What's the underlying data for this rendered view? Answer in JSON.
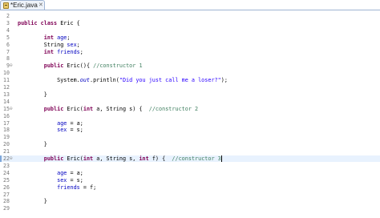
{
  "tab": {
    "label": "*Eric.java",
    "icon": "java-file-icon",
    "close_icon": "close-icon",
    "close_glyph": "✕"
  },
  "fold_glyph": "⊖",
  "colors": {
    "keyword": "#7f0055",
    "comment": "#3f7f5f",
    "string": "#2a00ff",
    "field": "#0000c0",
    "current_line": "#e8f2fe"
  },
  "current_line": 22,
  "lines": [
    {
      "num": "2",
      "fold": false,
      "tokens": []
    },
    {
      "num": "3",
      "fold": false,
      "tokens": [
        {
          "t": "kw",
          "v": "public"
        },
        {
          "t": "tx",
          "v": " "
        },
        {
          "t": "kw",
          "v": "class"
        },
        {
          "t": "tx",
          "v": " Eric {"
        }
      ]
    },
    {
      "num": "4",
      "fold": false,
      "tokens": []
    },
    {
      "num": "5",
      "fold": false,
      "tokens": [
        {
          "t": "tx",
          "v": "        "
        },
        {
          "t": "kw",
          "v": "int"
        },
        {
          "t": "tx",
          "v": " "
        },
        {
          "t": "fd",
          "v": "age"
        },
        {
          "t": "tx",
          "v": ";"
        }
      ]
    },
    {
      "num": "6",
      "fold": false,
      "tokens": [
        {
          "t": "tx",
          "v": "        String "
        },
        {
          "t": "fd",
          "v": "sex"
        },
        {
          "t": "tx",
          "v": ";"
        }
      ]
    },
    {
      "num": "7",
      "fold": false,
      "tokens": [
        {
          "t": "tx",
          "v": "        "
        },
        {
          "t": "kw",
          "v": "int"
        },
        {
          "t": "tx",
          "v": " "
        },
        {
          "t": "fd",
          "v": "friends"
        },
        {
          "t": "tx",
          "v": ";"
        }
      ]
    },
    {
      "num": "8",
      "fold": false,
      "tokens": []
    },
    {
      "num": "9",
      "fold": true,
      "tokens": [
        {
          "t": "tx",
          "v": "        "
        },
        {
          "t": "kw",
          "v": "public"
        },
        {
          "t": "tx",
          "v": " Eric(){ "
        },
        {
          "t": "cm",
          "v": "//constructor 1"
        }
      ]
    },
    {
      "num": "10",
      "fold": false,
      "tokens": []
    },
    {
      "num": "11",
      "fold": false,
      "tokens": [
        {
          "t": "tx",
          "v": "            System."
        },
        {
          "t": "fs",
          "v": "out"
        },
        {
          "t": "tx",
          "v": ".println("
        },
        {
          "t": "st",
          "v": "\"Did you just call me a loser?\""
        },
        {
          "t": "tx",
          "v": ");"
        }
      ]
    },
    {
      "num": "12",
      "fold": false,
      "tokens": []
    },
    {
      "num": "13",
      "fold": false,
      "tokens": [
        {
          "t": "tx",
          "v": "        }"
        }
      ]
    },
    {
      "num": "14",
      "fold": false,
      "tokens": []
    },
    {
      "num": "15",
      "fold": true,
      "tokens": [
        {
          "t": "tx",
          "v": "        "
        },
        {
          "t": "kw",
          "v": "public"
        },
        {
          "t": "tx",
          "v": " Eric("
        },
        {
          "t": "kw",
          "v": "int"
        },
        {
          "t": "tx",
          "v": " a, String s) {  "
        },
        {
          "t": "cm",
          "v": "//constructor 2"
        }
      ]
    },
    {
      "num": "16",
      "fold": false,
      "tokens": []
    },
    {
      "num": "17",
      "fold": false,
      "tokens": [
        {
          "t": "tx",
          "v": "            "
        },
        {
          "t": "fd",
          "v": "age"
        },
        {
          "t": "tx",
          "v": " = a;"
        }
      ]
    },
    {
      "num": "18",
      "fold": false,
      "tokens": [
        {
          "t": "tx",
          "v": "            "
        },
        {
          "t": "fd",
          "v": "sex"
        },
        {
          "t": "tx",
          "v": " = s;"
        }
      ]
    },
    {
      "num": "19",
      "fold": false,
      "tokens": []
    },
    {
      "num": "20",
      "fold": false,
      "tokens": [
        {
          "t": "tx",
          "v": "        }"
        }
      ]
    },
    {
      "num": "21",
      "fold": false,
      "tokens": []
    },
    {
      "num": "22",
      "fold": true,
      "tokens": [
        {
          "t": "tx",
          "v": "        "
        },
        {
          "t": "kw",
          "v": "public"
        },
        {
          "t": "tx",
          "v": " Eric("
        },
        {
          "t": "kw",
          "v": "int"
        },
        {
          "t": "tx",
          "v": " a, String s, "
        },
        {
          "t": "kw",
          "v": "int"
        },
        {
          "t": "tx",
          "v": " f) {  "
        },
        {
          "t": "cm",
          "v": "//constructor 3"
        },
        {
          "t": "caret",
          "v": ""
        }
      ]
    },
    {
      "num": "23",
      "fold": false,
      "tokens": []
    },
    {
      "num": "24",
      "fold": false,
      "tokens": [
        {
          "t": "tx",
          "v": "            "
        },
        {
          "t": "fd",
          "v": "age"
        },
        {
          "t": "tx",
          "v": " = a;"
        }
      ]
    },
    {
      "num": "25",
      "fold": false,
      "tokens": [
        {
          "t": "tx",
          "v": "            "
        },
        {
          "t": "fd",
          "v": "sex"
        },
        {
          "t": "tx",
          "v": " = s;"
        }
      ]
    },
    {
      "num": "26",
      "fold": false,
      "tokens": [
        {
          "t": "tx",
          "v": "            "
        },
        {
          "t": "fd",
          "v": "friends"
        },
        {
          "t": "tx",
          "v": " = f;"
        }
      ]
    },
    {
      "num": "27",
      "fold": false,
      "tokens": []
    },
    {
      "num": "28",
      "fold": false,
      "tokens": [
        {
          "t": "tx",
          "v": "        }"
        }
      ]
    },
    {
      "num": "29",
      "fold": false,
      "tokens": []
    }
  ]
}
